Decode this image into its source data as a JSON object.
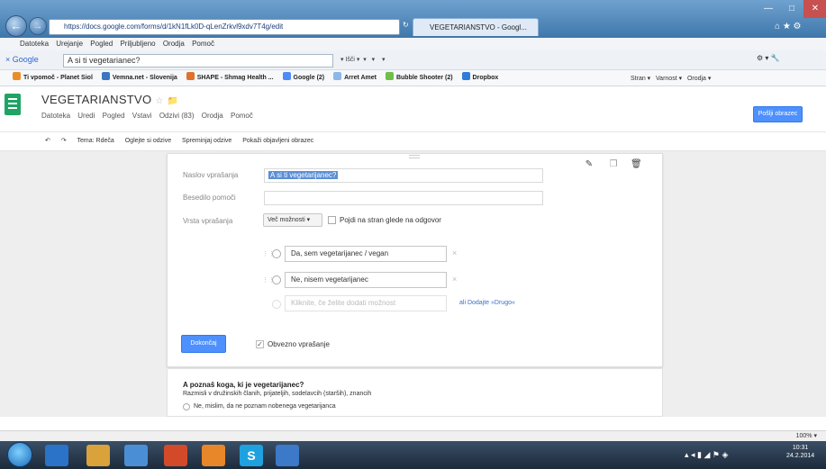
{
  "browser": {
    "address": "https://docs.google.com/forms/d/1kN1fLk0D-qLenZrkvl9xdv7T4g/edit",
    "tab_title": "VEGETARIANSTVO - Googl...",
    "menu": [
      "Datoteka",
      "Urejanje",
      "Pogled",
      "Priljubljeno",
      "Orodja",
      "Pomoč"
    ],
    "google_search_value": "A si ti vegetarianec?",
    "favorites": [
      "Ti vpomoč - Planet Siol",
      "Vemna.net - Slovenija",
      "SHAPE - Shmag Health ...",
      "Google (2)",
      "Arret Amet",
      "Bubble Shooter (2)",
      "Dropbox"
    ],
    "favorites_right": [
      "Stran",
      "Varnost",
      "Orodja"
    ],
    "status_zoom": "100%"
  },
  "docs": {
    "title": "VEGETARIANSTVO",
    "menu": [
      "Datoteka",
      "Uredi",
      "Pogled",
      "Vstavi",
      "Odzivi (83)",
      "Orodja",
      "Pomoč"
    ],
    "send_button": "Pošlji obrazec",
    "toolbar": [
      "Tema: Rdeča",
      "Oglejte si odzive",
      "Spreminjaj odzive",
      "Pokaži objavljeni obrazec"
    ]
  },
  "question": {
    "title_label": "Naslov vprašanja",
    "title_value": "A si ti vegetarijanec?",
    "help_label": "Besedilo pomoči",
    "help_value": "",
    "type_label": "Vrsta vprašanja",
    "type_value": "Več možnosti",
    "goto_label": "Pojdi na stran glede na odgovor",
    "options": [
      "Da, sem vegetarijanec / vegan",
      "Ne, nisem vegetarijanec"
    ],
    "add_option_placeholder": "Kliknite, če želite dodati možnost",
    "add_other": "ali Dodajte »Drugo«",
    "done_button": "Dokončaj",
    "required_label": "Obvezno vprašanje"
  },
  "next_question": {
    "title": "A poznaš koga, ki je vegetarijanec?",
    "help": "Razmisli v družinskih članih, prijateljih, sodelavcih (starših), znancih",
    "option": "Ne, mislim, da ne poznam nobenega vegetarijanca"
  },
  "clock": {
    "time": "10:31",
    "date": "24.2.2014"
  }
}
